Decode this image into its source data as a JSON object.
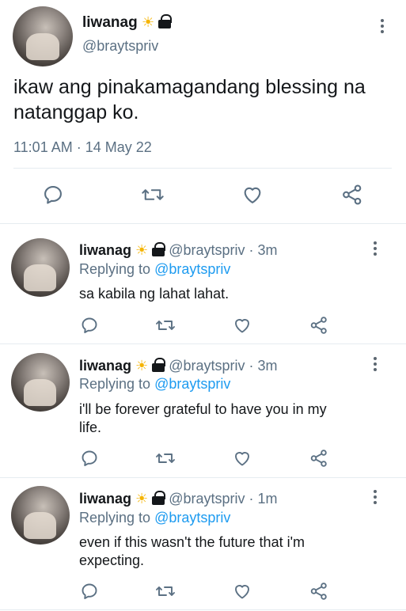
{
  "main_tweet": {
    "display_name": "liwanag",
    "handle": "@braytspriv",
    "text_line1": "ikaw ang pinakamagandang blessing na",
    "text_line2": "natanggap ko.",
    "timestamp": "11:01 AM · 14 May 22",
    "badge_emoji": "☀️"
  },
  "replies": [
    {
      "display_name": "liwanag",
      "handle_time": "@braytspriv · 3m",
      "replying_prefix": "Replying to",
      "replying_to": "@braytspriv",
      "text_line1": "sa kabila ng lahat lahat.",
      "text_line2": ""
    },
    {
      "display_name": "liwanag",
      "handle_time": "@braytspriv · 3m",
      "replying_prefix": "Replying to",
      "replying_to": "@braytspriv",
      "text_line1": "i'll be forever grateful to have you in my",
      "text_line2": "life."
    },
    {
      "display_name": "liwanag",
      "handle_time": "@braytspriv · 1m",
      "replying_prefix": "Replying to",
      "replying_to": "@braytspriv",
      "text_line1": "even if this wasn't the future that i'm",
      "text_line2": "expecting."
    }
  ],
  "icons": {
    "reply": "reply-icon",
    "retweet": "retweet-icon",
    "like": "heart-icon",
    "share": "share-icon",
    "more": "more-options-icon",
    "lock": "lock-icon",
    "sun": "sun-emoji-icon"
  },
  "colors": {
    "text": "#14171a",
    "muted": "#5b7083",
    "link": "#1d9bf0",
    "icon": "#5b7083",
    "divider": "#e6ecf0"
  }
}
